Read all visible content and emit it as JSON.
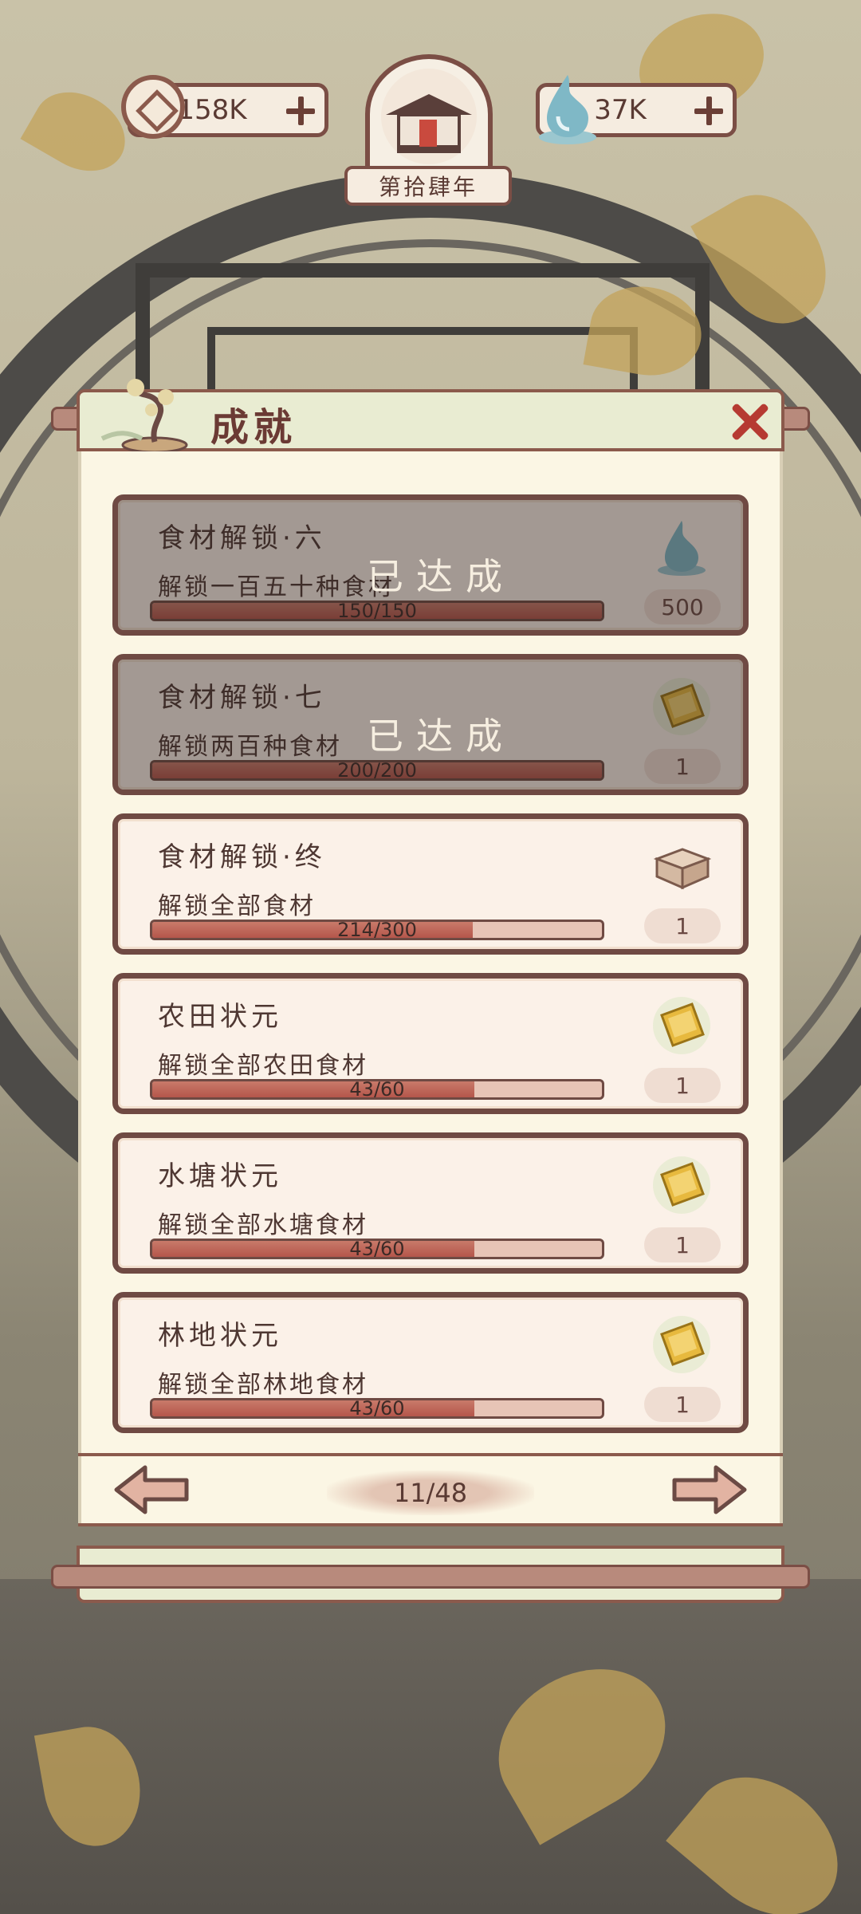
{
  "hud": {
    "coins": "158K",
    "jade": "37K",
    "year": "第拾肆年"
  },
  "panel": {
    "title": "成就",
    "done_label": "已达成"
  },
  "achievements": [
    {
      "title": "食材解锁·六",
      "desc": "解锁一百五十种食材",
      "progress_text": "150/150",
      "progress": 1.0,
      "reward_icon": "water-drop-icon",
      "reward_count": "500",
      "completed": true
    },
    {
      "title": "食材解锁·七",
      "desc": "解锁两百种食材",
      "progress_text": "200/200",
      "progress": 1.0,
      "reward_icon": "ticket-icon",
      "reward_count": "1",
      "completed": true
    },
    {
      "title": "食材解锁·终",
      "desc": "解锁全部食材",
      "progress_text": "214/300",
      "progress": 0.713,
      "reward_icon": "wooden-box-icon",
      "reward_count": "1",
      "completed": false
    },
    {
      "title": "农田状元",
      "desc": "解锁全部农田食材",
      "progress_text": "43/60",
      "progress": 0.717,
      "reward_icon": "ticket-icon",
      "reward_count": "1",
      "completed": false
    },
    {
      "title": "水塘状元",
      "desc": "解锁全部水塘食材",
      "progress_text": "43/60",
      "progress": 0.717,
      "reward_icon": "ticket-icon",
      "reward_count": "1",
      "completed": false
    },
    {
      "title": "林地状元",
      "desc": "解锁全部林地食材",
      "progress_text": "43/60",
      "progress": 0.717,
      "reward_icon": "ticket-icon",
      "reward_count": "1",
      "completed": false
    }
  ],
  "pagination": {
    "page": "11/48"
  },
  "colors": {
    "frame": "#6f4a43",
    "card_bg": "#fbf1e8",
    "bar_fill": "#b5564b",
    "panel_bg": "#fbf6e4",
    "header_bg": "#e9ecd2"
  }
}
